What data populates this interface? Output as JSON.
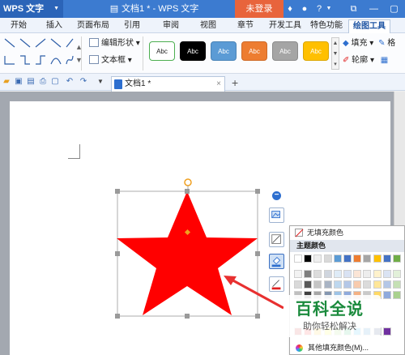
{
  "titlebar": {
    "app_label": "WPS 文字",
    "document_title": "文档1 * - WPS 文字",
    "login_label": "未登录",
    "help_label": "?"
  },
  "menu": {
    "tabs": [
      "开始",
      "插入",
      "页面布局",
      "引用",
      "审阅",
      "视图",
      "章节",
      "开发工具",
      "特色功能",
      "绘图工具"
    ],
    "active_tab": "绘图工具"
  },
  "ribbon": {
    "edit_shape_label": "编辑形状",
    "text_box_label": "文本框",
    "style_presets": [
      {
        "label": "Abc",
        "fill": "#ffffff",
        "border": "#4caf50",
        "text": "#222222"
      },
      {
        "label": "Abc",
        "fill": "#000000",
        "border": "#000000",
        "text": "#ffffff"
      },
      {
        "label": "Abc",
        "fill": "#5b9bd5",
        "border": "#4a84b8",
        "text": "#ffffff"
      },
      {
        "label": "Abc",
        "fill": "#ed7d31",
        "border": "#cf6a28",
        "text": "#ffffff"
      },
      {
        "label": "Abc",
        "fill": "#a5a5a5",
        "border": "#8c8c8c",
        "text": "#ffffff"
      },
      {
        "label": "Abc",
        "fill": "#ffc000",
        "border": "#dca600",
        "text": "#ffffff"
      }
    ],
    "fill_label": "填充",
    "outline_label": "轮廓",
    "right_trunc_label": "格"
  },
  "document_tab": {
    "label": "文档1 *"
  },
  "fill_menu": {
    "no_fill_label": "无填充颜色",
    "theme_colors_label": "主题颜色",
    "more_fill_label": "其他填充颜色(M)...",
    "swatch_rows": [
      [
        "#ffffff",
        "#000000",
        "#eeeeee",
        "#d9d9d9",
        "#5b9bd5",
        "#4472c4",
        "#ed7d31",
        "#a5a5a5",
        "#ffc000",
        "#4472c4",
        "#70ad47"
      ],
      [
        "#f2f2f2",
        "#7f7f7f",
        "#dcdcdc",
        "#cfd5de",
        "#deebf7",
        "#d9e2f3",
        "#fbe5d6",
        "#ededed",
        "#fff2cc",
        "#dae3f3",
        "#e2f0d9"
      ],
      [
        "#d9d9d9",
        "#595959",
        "#c4c4c4",
        "#a9b4c4",
        "#bdd7ee",
        "#b4c7e7",
        "#f8cbad",
        "#dbdbdb",
        "#ffe699",
        "#b4c7e7",
        "#c5e0b4"
      ],
      [
        "#bfbfbf",
        "#3f3f3f",
        "#a6a6a6",
        "#8496b0",
        "#9dc3e6",
        "#8faadc",
        "#f4b183",
        "#c9c9c9",
        "#ffd966",
        "#8faadc",
        "#a9d18e"
      ]
    ],
    "standard_colors": [
      "#c00000",
      "#ff0000",
      "#ffc000",
      "#ffff00",
      "#92d050",
      "#00b050",
      "#00b0f0",
      "#0070c0",
      "#002060",
      "#7030a0"
    ]
  },
  "shape": {
    "fill_color": "#ff0000",
    "name": "star"
  },
  "watermark": {
    "title": "百科全说",
    "subtitle": "助你轻松解决"
  }
}
